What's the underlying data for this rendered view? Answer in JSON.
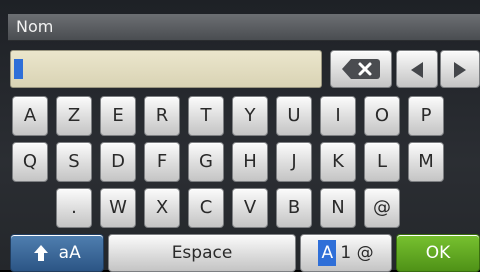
{
  "header": {
    "title": "Nom"
  },
  "input": {
    "value": ""
  },
  "keyboard": {
    "row1": [
      "A",
      "Z",
      "E",
      "R",
      "T",
      "Y",
      "U",
      "I",
      "O",
      "P"
    ],
    "row2": [
      "Q",
      "S",
      "D",
      "F",
      "G",
      "H",
      "J",
      "K",
      "L",
      "M"
    ],
    "row3": [
      ".",
      "W",
      "X",
      "C",
      "V",
      "B",
      "N",
      "@"
    ]
  },
  "controls": {
    "backspace_icon": "backspace-icon",
    "left_icon": "arrow-left-icon",
    "right_icon": "arrow-right-icon",
    "shift_icon": "arrow-up-icon",
    "shift_label": "aA",
    "space_label": "Espace",
    "mode_active": "A",
    "mode_rest": "1 @",
    "ok_label": "OK"
  },
  "colors": {
    "input_bg": "#e4dfc3",
    "caret": "#2f6fd8",
    "shift_key": "#3a6a9e",
    "ok_key": "#62a823",
    "mode_highlight": "#2f6fd8"
  }
}
